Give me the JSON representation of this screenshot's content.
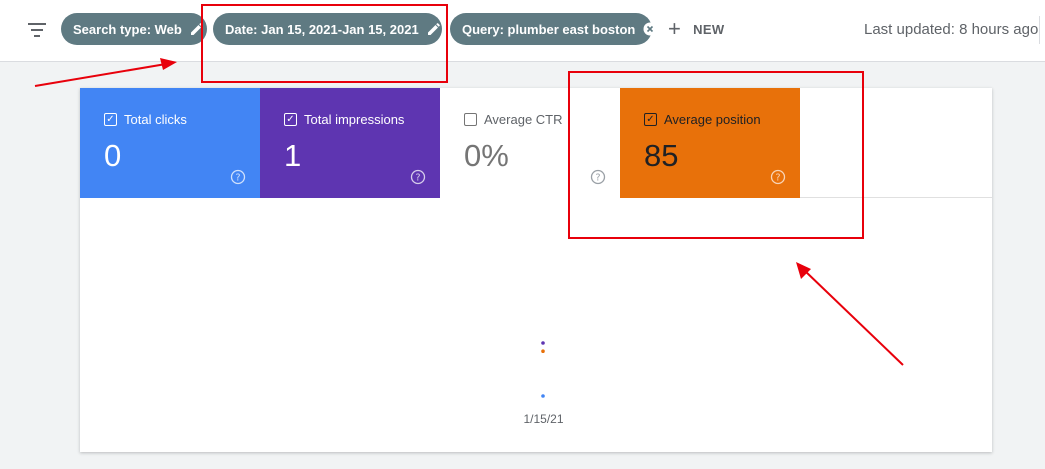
{
  "toolbar": {
    "filter_icon": "filter-list-icon",
    "chips": [
      {
        "label": "Search type: Web",
        "icon": "pencil-icon"
      },
      {
        "label": "Date: Jan 15, 2021-Jan 15, 2021",
        "icon": "pencil-icon"
      },
      {
        "label": "Query: plumber east boston",
        "icon": "close-circle-icon"
      }
    ],
    "new_label": "NEW",
    "last_updated": "Last updated: 8 hours ago"
  },
  "metrics": [
    {
      "label": "Total clicks",
      "value": "0",
      "checked": true,
      "color": "#4285f4"
    },
    {
      "label": "Total impressions",
      "value": "1",
      "checked": true,
      "color": "#5e35b1"
    },
    {
      "label": "Average CTR",
      "value": "0%",
      "checked": false,
      "color": "#ffffff"
    },
    {
      "label": "Average position",
      "value": "85",
      "checked": true,
      "color": "#e8710a"
    }
  ],
  "chart_data": {
    "type": "scatter",
    "x": [
      "1/15/21"
    ],
    "series": [
      {
        "values": [
          0
        ],
        "color": "#4285f4"
      },
      {
        "values": [
          1
        ],
        "color": "#5e35b1"
      },
      {
        "values": [
          85
        ],
        "color": "#e8710a"
      }
    ]
  },
  "annotation_color": "#e8000b"
}
